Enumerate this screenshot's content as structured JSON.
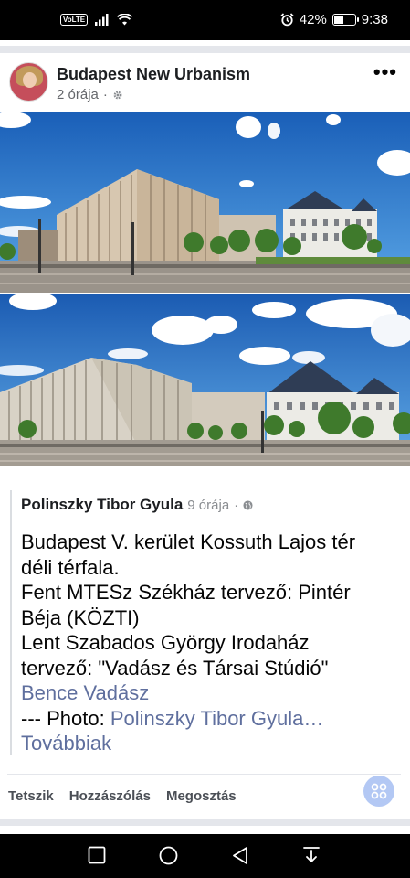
{
  "status_bar": {
    "network_badge": "VoLTE",
    "battery_percent": "42%",
    "battery_level": 0.42,
    "time": "9:38",
    "icons": [
      "volte-icon",
      "signal-icon",
      "wifi-icon",
      "alarm-icon",
      "battery-icon"
    ]
  },
  "post": {
    "page_name": "Budapest New Urbanism",
    "time": "2 órája",
    "audience_icon": "settings-icon",
    "more_label": "•••"
  },
  "shared": {
    "author": "Polinszky Tibor Gyula",
    "time": "9 órája",
    "audience_icon": "globe-icon",
    "lines": [
      "Budapest V. kerület Kossuth Lajos tér",
      "déli térfala.",
      "Fent MTESz Székház tervező: Pintér",
      "Béja (KÖZTI)",
      "Lent Szabados György Irodaház",
      "tervező: \"Vadász és Társai Stúdió\""
    ],
    "mention": "Bence Vadász",
    "photo_prefix": "--- Photo: ",
    "photo_link": "Polinszky Tibor Gyula…",
    "more_link": "Továbbiak"
  },
  "actions": {
    "like": "Tetszik",
    "comment": "Hozzászólás",
    "share": "Megosztás"
  },
  "colors": {
    "accent_link": "#5f6f9e",
    "fab": "#b3c8f4"
  }
}
